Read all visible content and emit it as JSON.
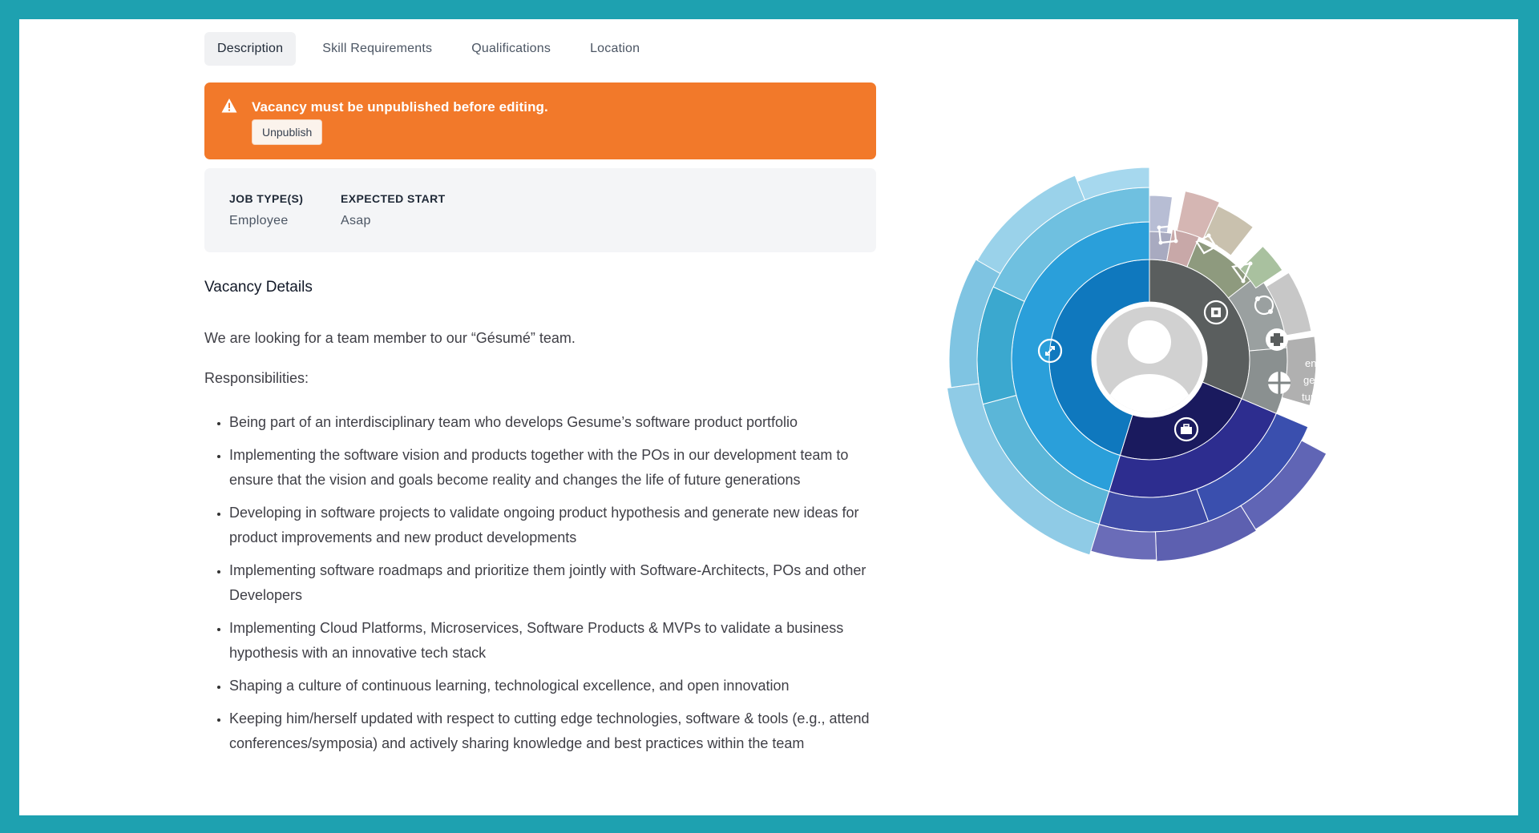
{
  "tabs": [
    {
      "label": "Description",
      "active": true
    },
    {
      "label": "Skill Requirements",
      "active": false
    },
    {
      "label": "Qualifications",
      "active": false
    },
    {
      "label": "Location",
      "active": false
    }
  ],
  "alert": {
    "message": "Vacancy must be unpublished before editing.",
    "button_label": "Unpublish",
    "icon": "warning-icon",
    "color": "#f2792a"
  },
  "info": {
    "job_type_label": "JOB TYPE(S)",
    "job_type_value": "Employee",
    "expected_start_label": "EXPECTED START",
    "expected_start_value": "Asap"
  },
  "vacancy": {
    "title": "Vacancy Details",
    "intro": "We are looking for a team member to our “Gésumé” team.",
    "responsibilities_label": "Responsibilities:",
    "responsibilities": [
      "Being part of an interdisciplinary team who develops Gesume’s software product portfolio",
      "Implementing the software vision and products together with the POs in our development team to ensure that the vision and goals become reality and changes the life of future generations",
      "Developing in software projects to validate ongoing product hypothesis and generate new ideas for product improvements and new product developments",
      "Implementing software roadmaps and prioritize them jointly with Software-Architects, POs and other Developers",
      "Implementing Cloud Platforms, Microservices, Software Products & MVPs to validate a business hypothesis with an innovative tech stack",
      "Shaping a culture of continuous learning, technological excellence, and open innovation",
      "Keeping him/herself updated with respect to cutting edge technologies, software & tools (e.g., attend conferences/symposia) and actively sharing knowledge and best practices within the team"
    ]
  },
  "sunburst": {
    "languages": [
      "eng",
      "ger",
      "tur"
    ],
    "colors": {
      "blue": "#1d9ad6",
      "navy": "#1a1a5e",
      "gray": "#5a5e5e"
    }
  }
}
